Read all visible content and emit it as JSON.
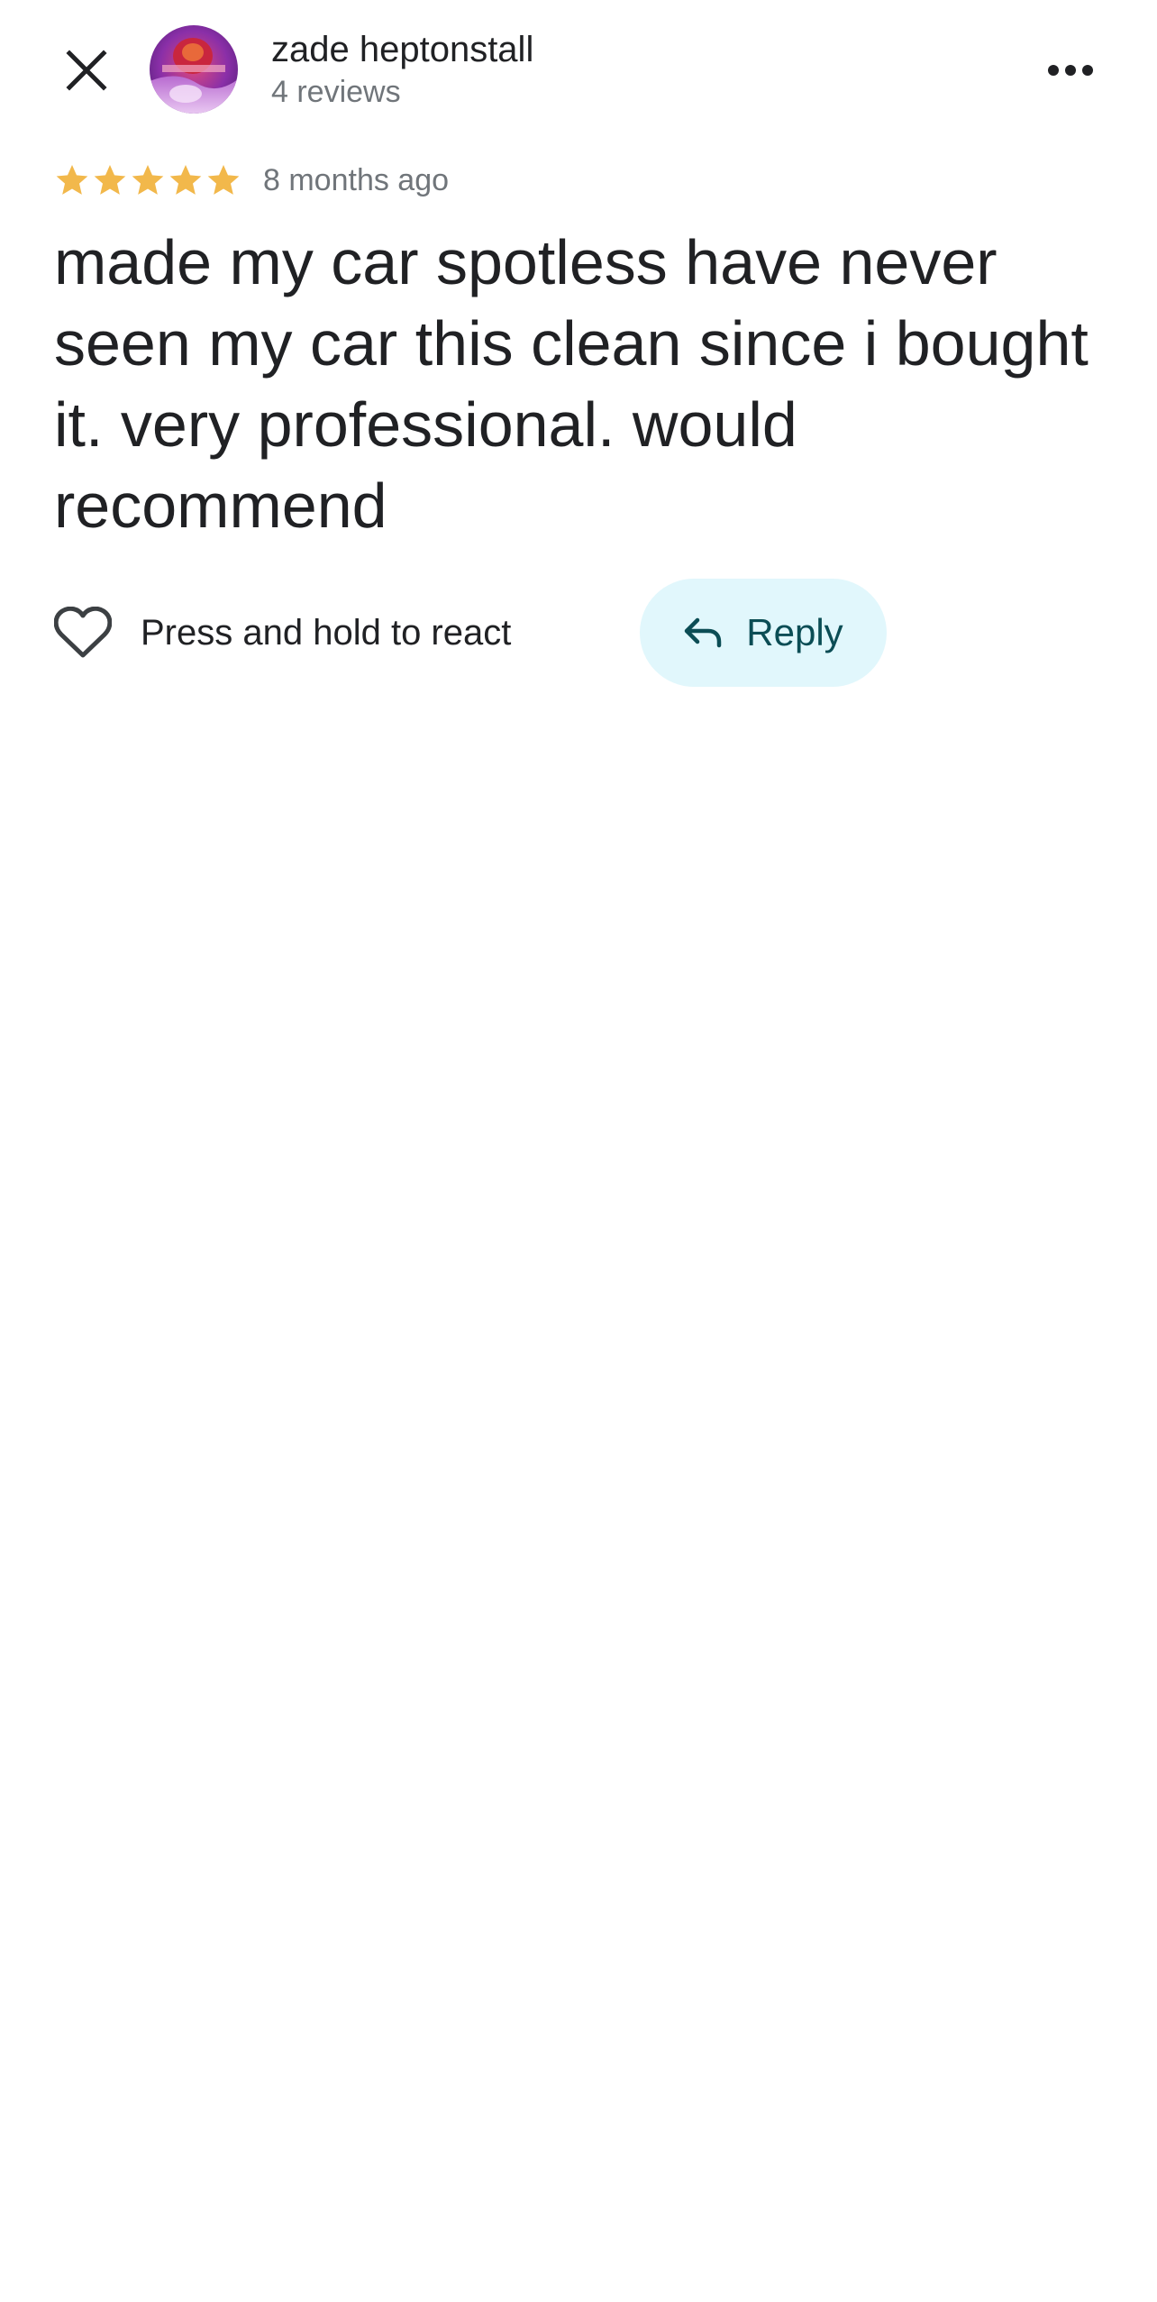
{
  "header": {
    "close_icon": "close-icon",
    "user_name": "zade heptonstall",
    "review_count": "4 reviews",
    "avatar_icon": "avatar-image",
    "more_icon": "more-horizontal-icon"
  },
  "review": {
    "rating": 5,
    "rating_max": 5,
    "star_color": "#F2B84B",
    "date": "8 months ago",
    "text": "made my car spotless have never seen my car this clean since i bought it. very professional. would recommend"
  },
  "actions": {
    "react_icon": "heart-outline-icon",
    "react_label": "Press and hold to react",
    "reply_icon": "reply-arrow-icon",
    "reply_label": "Reply",
    "reply_bg_color": "#E1F7FC",
    "reply_text_color": "#0B4D55"
  }
}
